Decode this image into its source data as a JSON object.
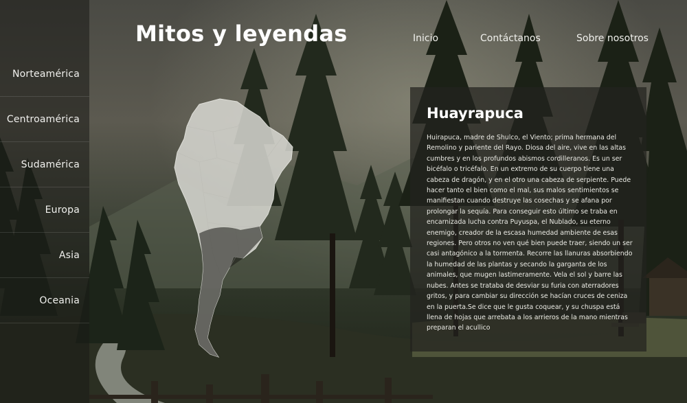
{
  "header": {
    "site_title": "Mitos y leyendas",
    "nav": [
      "Inicio",
      "Contáctanos",
      "Sobre nosotros"
    ]
  },
  "sidebar": {
    "items": [
      {
        "label": "Norteamérica"
      },
      {
        "label": "Centroamérica"
      },
      {
        "label": "Sudamérica"
      },
      {
        "label": "Europa"
      },
      {
        "label": "Asia"
      },
      {
        "label": "Oceania"
      }
    ]
  },
  "map": {
    "region": "south-america-map"
  },
  "article": {
    "title": "Huayrapuca",
    "body": "Huirapuca, madre de Shulco, el Viento; prima hermana del Remolino y pariente del Rayo. Diosa del aire, vive en las altas cumbres y en los profundos abismos cordilleranos. Es un ser bicéfalo o tricéfalo. En un extremo de su cuerpo tiene una cabeza de dragón, y en el otro una cabeza de serpiente. Puede hacer tanto el bien como el mal, sus malos sentimientos se manifiestan cuando destruye las cosechas y se afana por prolongar la sequía. Para conseguir esto último se traba en encarnizada lucha contra Puyuspa, el Nublado, su eterno enemigo, creador de la escasa humedad ambiente de esas regiones. Pero otros no ven qué bien puede traer, siendo un ser casi antagónico a la tormenta. Recorre las llanuras absorbiendo la humedad de las plantas y secando la garganta de los animales, que mugen lastimeramente. Vela el sol y barre las nubes. Antes se trataba de desviar su furia con aterradores gritos, y para cambiar su dirección se hacían cruces de ceniza en la puerta.Se dice que le gusta coquear, y su chuspa está llena de hojas que arrebata a los arrieros de la mano mientras preparan el acullico"
  },
  "colors": {
    "sidebar_bg": "#19191680",
    "panel_bg": "#232320b8",
    "map_fill": "#dcdcd6"
  }
}
